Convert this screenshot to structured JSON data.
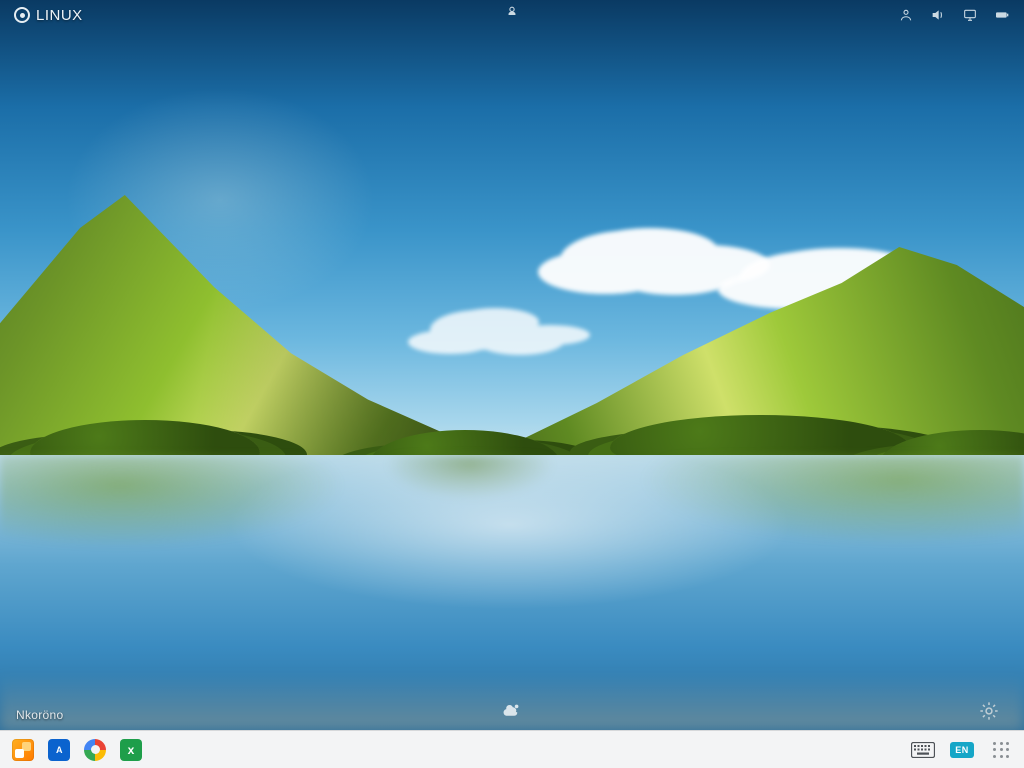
{
  "brand": {
    "name": "Linux"
  },
  "watermark": "Nkoröno",
  "topbar": {
    "center_icon": "system-indicator-icon",
    "tray": [
      {
        "name": "user-icon"
      },
      {
        "name": "volume-icon"
      },
      {
        "name": "network-icon"
      },
      {
        "name": "battery-icon"
      }
    ]
  },
  "overlay": {
    "center_icon": "launcher-icon",
    "right_icon": "settings-icon"
  },
  "taskbar": {
    "apps": [
      {
        "name": "files-app",
        "glyph": ""
      },
      {
        "name": "word-processor-app",
        "glyph": "A"
      },
      {
        "name": "browser-app",
        "glyph": ""
      },
      {
        "name": "spreadsheet-app",
        "glyph": "x"
      }
    ],
    "status": {
      "keyboard_icon": "keyboard-icon",
      "lang_badge": "EN",
      "menu_icon": "app-grid-icon"
    }
  },
  "colors": {
    "sky_top": "#0a3a63",
    "sky_bottom": "#c9e4ef",
    "grass": "#8fbf2f",
    "lake": "#3a8bc0",
    "taskbar": "#f3f4f5"
  }
}
